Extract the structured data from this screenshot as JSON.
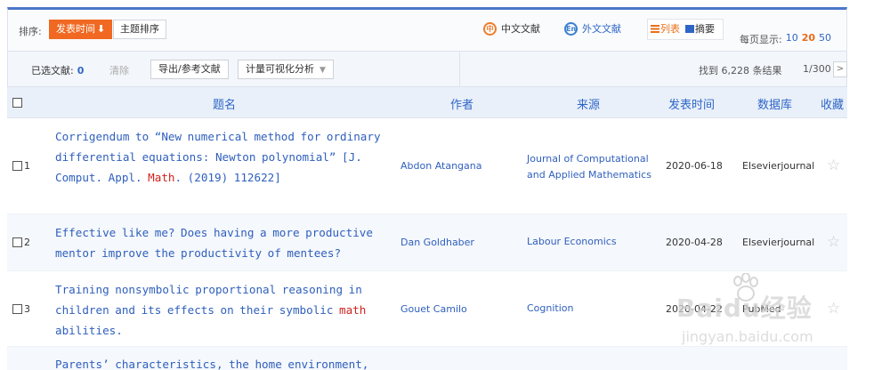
{
  "sortbar": {
    "label": "排序:",
    "buttons": [
      {
        "label": "发表时间",
        "arrow": "⬇",
        "active": true
      },
      {
        "label": "主题排序",
        "active": false
      }
    ],
    "lang_zh": {
      "label": "中文文献",
      "icon": "zh-icon",
      "icon_text": "中"
    },
    "lang_en": {
      "label": "外文文献",
      "icon": "en-icon",
      "icon_text": "En"
    },
    "view_list": {
      "label": "列表",
      "icon": "list-icon"
    },
    "view_abstract": {
      "label": "摘要",
      "icon": "abstract-icon"
    },
    "perpage": {
      "label": "每页显示:",
      "options": [
        "10",
        "20",
        "50"
      ],
      "selected": "20"
    }
  },
  "selbar": {
    "selected_label": "已选文献:",
    "selected_count": "0",
    "clear": "清除",
    "export": "导出/参考文献",
    "visualize": "计量可视化分析",
    "found": "找到 6,228 条结果",
    "page": "1/300",
    "next": ">"
  },
  "table": {
    "headers": {
      "title": "题名",
      "author": "作者",
      "source": "来源",
      "date": "发表时间",
      "db": "数据库",
      "fav": "收藏"
    },
    "rows": [
      {
        "index": "1",
        "title_parts": [
          "Corrigendum to “New numerical method for ordinary differential equations: Newton polynomial” [J. Comput. Appl. ",
          "Math",
          ". (2019) 112622]"
        ],
        "author": "Abdon Atangana",
        "source": "Journal of Computational and Applied Mathematics",
        "date": "2020-06-18",
        "db": "Elsevierjournal",
        "star": "☆"
      },
      {
        "index": "2",
        "title_parts": [
          "Effective like me? Does having a more productive mentor improve the productivity of mentees?"
        ],
        "author": "Dan Goldhaber",
        "source": "Labour Economics",
        "date": "2020-04-28",
        "db": "Elsevierjournal",
        "star": "☆"
      },
      {
        "index": "3",
        "title_parts": [
          "Training nonsymbolic proportional reasoning in children and its effects on their symbolic ",
          "math",
          " abilities."
        ],
        "author": "Gouet Camilo",
        "source": "Cognition",
        "date": "2020-04-22",
        "db": "PubMed",
        "star": "☆"
      },
      {
        "index": "4",
        "title_parts": [
          "Parents’ characteristics, the home environment,"
        ],
        "author": "",
        "source": "",
        "date": "",
        "db": "",
        "star": ""
      }
    ]
  },
  "watermark": {
    "brand": "Baidu经验",
    "sub": "jingyan.baidu.com"
  },
  "colors": {
    "accent_orange": "#f06821",
    "link_blue": "#2f5fbd",
    "highlight_red": "#d0211f",
    "header_bg": "#e9f0fa"
  }
}
